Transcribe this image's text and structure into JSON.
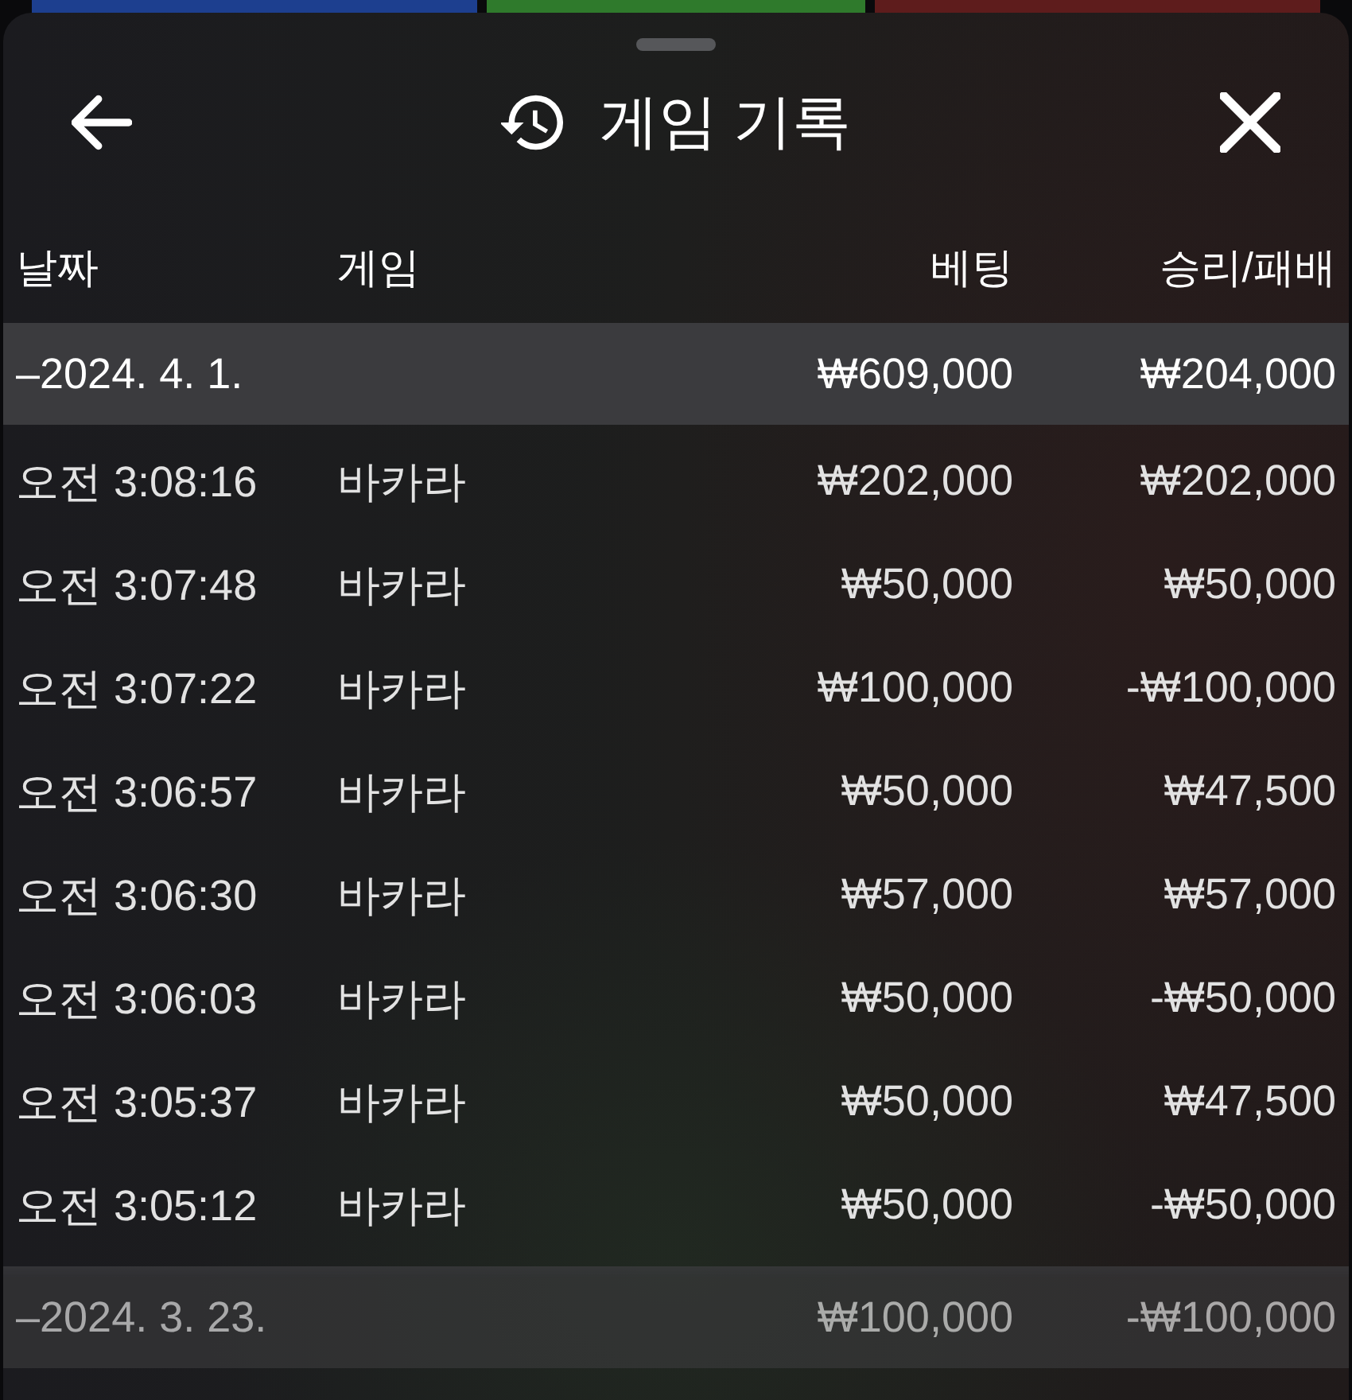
{
  "sheet": {
    "title": "게임 기록"
  },
  "columns": [
    "날짜",
    "게임",
    "베팅",
    "승리/패배"
  ],
  "groups": [
    {
      "date": "–2024. 4. 1.",
      "bet": "₩609,000",
      "result": "₩204,000",
      "rows": [
        {
          "time": "오전 3:08:16",
          "game": "바카라",
          "bet": "₩202,000",
          "result": "₩202,000"
        },
        {
          "time": "오전 3:07:48",
          "game": "바카라",
          "bet": "₩50,000",
          "result": "₩50,000"
        },
        {
          "time": "오전 3:07:22",
          "game": "바카라",
          "bet": "₩100,000",
          "result": "-₩100,000"
        },
        {
          "time": "오전 3:06:57",
          "game": "바카라",
          "bet": "₩50,000",
          "result": "₩47,500"
        },
        {
          "time": "오전 3:06:30",
          "game": "바카라",
          "bet": "₩57,000",
          "result": "₩57,000"
        },
        {
          "time": "오전 3:06:03",
          "game": "바카라",
          "bet": "₩50,000",
          "result": "-₩50,000"
        },
        {
          "time": "오전 3:05:37",
          "game": "바카라",
          "bet": "₩50,000",
          "result": "₩47,500"
        },
        {
          "time": "오전 3:05:12",
          "game": "바카라",
          "bet": "₩50,000",
          "result": "-₩50,000"
        }
      ]
    },
    {
      "date": "–2024. 3. 23.",
      "bet": "₩100,000",
      "result": "-₩100,000"
    }
  ]
}
